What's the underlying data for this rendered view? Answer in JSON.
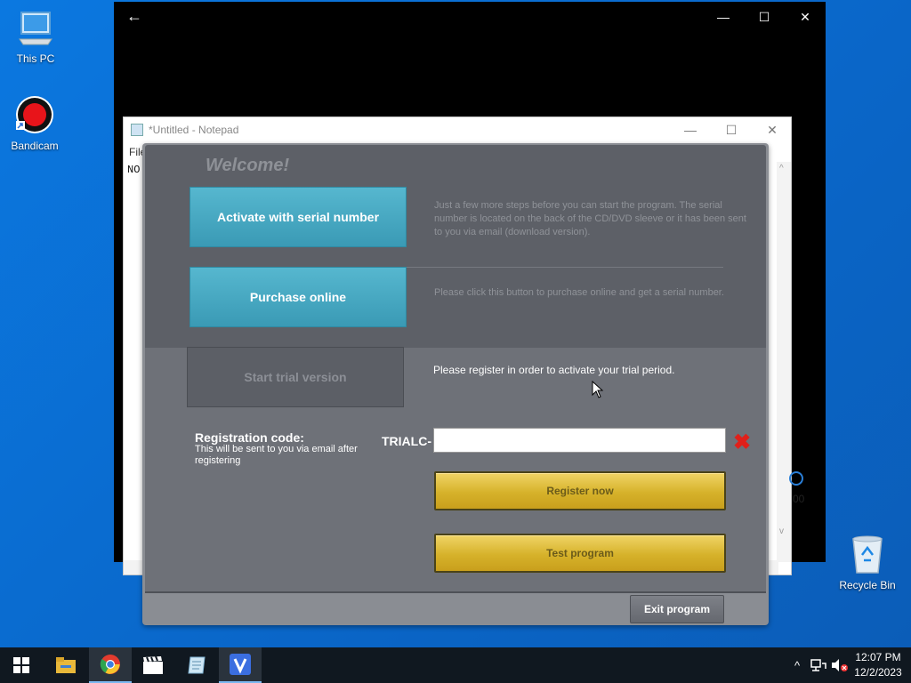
{
  "desktop": {
    "icons": [
      {
        "label": "This PC"
      },
      {
        "label": "Bandicam"
      },
      {
        "label": "Recycle Bin"
      }
    ]
  },
  "black_window": {
    "back_glyph": "←",
    "min_glyph": "—",
    "max_glyph": "☐",
    "close_glyph": "✕"
  },
  "notepad": {
    "title": "*Untitled - Notepad",
    "menu_first": "File",
    "text_start": "NO",
    "partial_right_text": "00"
  },
  "dialog": {
    "welcome": "Welcome!",
    "activate_label": "Activate with serial number",
    "activate_desc": "Just a few more steps before you can start the program. The serial number is located on the back of the CD/DVD sleeve or it has been sent to you via email (download version).",
    "purchase_label": "Purchase online",
    "purchase_desc": "Please click this button to purchase online and get a serial number.",
    "trial_label": "Start trial version",
    "trial_message": "Please register in order to activate your trial period.",
    "reg_title": "Registration code:",
    "reg_subtitle": "This will be sent to you via email after registering",
    "prefix": "TRIALC-",
    "code_value": "",
    "register_label": "Register now",
    "test_label": "Test program",
    "exit_label": "Exit program"
  },
  "taskbar": {
    "apps": [
      "start-icon",
      "file-explorer-icon",
      "chrome-icon",
      "clapperboard-icon",
      "notepad-icon",
      "v-app-icon"
    ],
    "time": "12:07 PM",
    "date": "12/2/2023"
  },
  "colors": {
    "accent_teal": "#3a9ab5",
    "gold": "#d6b22a",
    "dialog_bg": "#5d6067",
    "desktop": "#0a6fd1"
  }
}
